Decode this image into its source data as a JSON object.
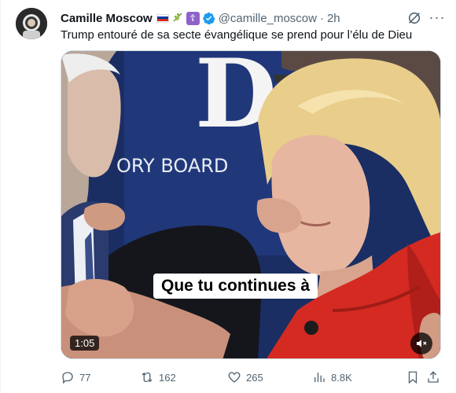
{
  "tweet": {
    "display_name": "Camille Moscow",
    "badges": [
      "russia-flag",
      "wheat-emoji",
      "orthodox-cross",
      "verified-badge"
    ],
    "handle": "@camille_moscow",
    "separator": "·",
    "time": "2h",
    "text": "Trump entouré de sa secte évangélique se prend pour l’élu de Dieu",
    "more_label": "···"
  },
  "media": {
    "type": "video",
    "background_letters": "D",
    "background_sign": "ORY BOARD",
    "subtitle": "Que tu continues à",
    "duration": "1:05",
    "mute_icon": "speaker-muted-icon"
  },
  "actions": {
    "replies": "77",
    "reposts": "162",
    "likes": "265",
    "views": "8.8K"
  },
  "colors": {
    "accent": "#1d9bf0",
    "muted": "#536471",
    "stage_blue": "#1a2e63",
    "jacket_red": "#d42a22"
  }
}
